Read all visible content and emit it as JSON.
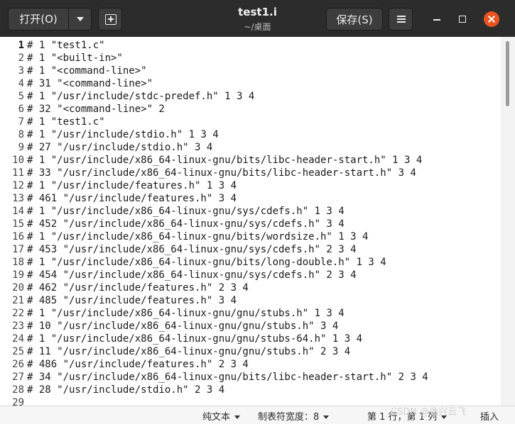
{
  "header": {
    "open_label": "打开(O)",
    "title": "test1.i",
    "subtitle": "~/桌面",
    "save_label": "保存(S)"
  },
  "lines": [
    {
      "n": "1",
      "text": "# 1 \"test1.c\""
    },
    {
      "n": "2",
      "text": "# 1 \"<built-in>\""
    },
    {
      "n": "3",
      "text": "# 1 \"<command-line>\""
    },
    {
      "n": "4",
      "text": "# 31 \"<command-line>\""
    },
    {
      "n": "5",
      "text": "# 1 \"/usr/include/stdc-predef.h\" 1 3 4"
    },
    {
      "n": "6",
      "text": "# 32 \"<command-line>\" 2"
    },
    {
      "n": "7",
      "text": "# 1 \"test1.c\""
    },
    {
      "n": "8",
      "text": "# 1 \"/usr/include/stdio.h\" 1 3 4"
    },
    {
      "n": "9",
      "text": "# 27 \"/usr/include/stdio.h\" 3 4"
    },
    {
      "n": "10",
      "text": "# 1 \"/usr/include/x86_64-linux-gnu/bits/libc-header-start.h\" 1 3 4"
    },
    {
      "n": "11",
      "text": "# 33 \"/usr/include/x86_64-linux-gnu/bits/libc-header-start.h\" 3 4"
    },
    {
      "n": "12",
      "text": "# 1 \"/usr/include/features.h\" 1 3 4"
    },
    {
      "n": "13",
      "text": "# 461 \"/usr/include/features.h\" 3 4"
    },
    {
      "n": "14",
      "text": "# 1 \"/usr/include/x86_64-linux-gnu/sys/cdefs.h\" 1 3 4"
    },
    {
      "n": "15",
      "text": "# 452 \"/usr/include/x86_64-linux-gnu/sys/cdefs.h\" 3 4"
    },
    {
      "n": "16",
      "text": "# 1 \"/usr/include/x86_64-linux-gnu/bits/wordsize.h\" 1 3 4"
    },
    {
      "n": "17",
      "text": "# 453 \"/usr/include/x86_64-linux-gnu/sys/cdefs.h\" 2 3 4"
    },
    {
      "n": "18",
      "text": "# 1 \"/usr/include/x86_64-linux-gnu/bits/long-double.h\" 1 3 4"
    },
    {
      "n": "19",
      "text": "# 454 \"/usr/include/x86_64-linux-gnu/sys/cdefs.h\" 2 3 4"
    },
    {
      "n": "20",
      "text": "# 462 \"/usr/include/features.h\" 2 3 4"
    },
    {
      "n": "21",
      "text": "# 485 \"/usr/include/features.h\" 3 4"
    },
    {
      "n": "22",
      "text": "# 1 \"/usr/include/x86_64-linux-gnu/gnu/stubs.h\" 1 3 4"
    },
    {
      "n": "23",
      "text": "# 10 \"/usr/include/x86_64-linux-gnu/gnu/stubs.h\" 3 4"
    },
    {
      "n": "24",
      "text": "# 1 \"/usr/include/x86_64-linux-gnu/gnu/stubs-64.h\" 1 3 4"
    },
    {
      "n": "25",
      "text": "# 11 \"/usr/include/x86_64-linux-gnu/gnu/stubs.h\" 2 3 4"
    },
    {
      "n": "26",
      "text": "# 486 \"/usr/include/features.h\" 2 3 4"
    },
    {
      "n": "27",
      "text": "# 34 \"/usr/include/x86_64-linux-gnu/bits/libc-header-start.h\" 2 3 4"
    },
    {
      "n": "28",
      "text": "# 28 \"/usr/include/stdio.h\" 2 3 4"
    },
    {
      "n": "29",
      "text": ""
    }
  ],
  "status": {
    "syntax": "纯文本",
    "tab_width": "制表符宽度：8",
    "position": "第 1 行，第 1 列",
    "mode": "插入"
  },
  "watermark": "CSDN @逸兴云飞"
}
